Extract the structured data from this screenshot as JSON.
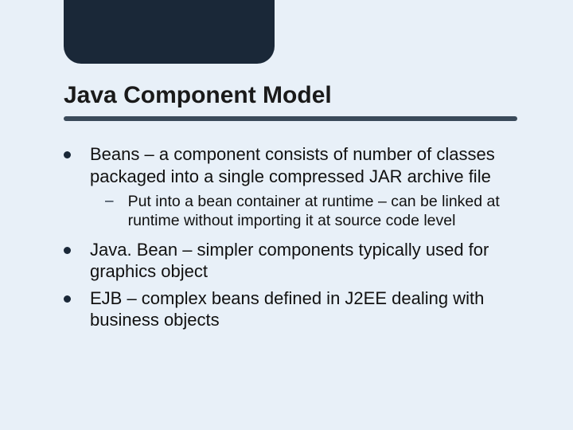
{
  "slide": {
    "title": "Java Component Model",
    "bullets": {
      "b1": "Beans – a component consists of number of classes packaged into a single compressed JAR archive file",
      "b1_sub1": "Put into a bean container at runtime – can be linked at runtime without importing it at source code level",
      "b2": "Java. Bean – simpler components typically used for graphics object",
      "b3": "EJB – complex beans defined in J2EE dealing with business objects"
    }
  }
}
